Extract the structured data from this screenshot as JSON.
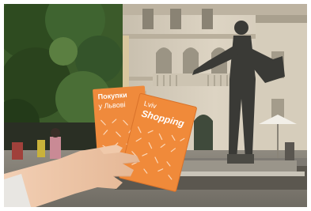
{
  "photo": {
    "booklet_back_title_line1": "Покупки",
    "booklet_back_title_line2": "у Львові",
    "booklet_front_title_line1": "Lviv",
    "booklet_front_title_line2": "Shopping",
    "colors": {
      "booklet_orange": "#ef8a3c",
      "booklet_orange_dark": "#d9722a",
      "sky": "#e9ecef",
      "building_wall": "#d8d0c0",
      "statue_bronze": "#3a3a36",
      "foliage": "#2f4a22",
      "umbrella": "#f2efe8"
    }
  }
}
